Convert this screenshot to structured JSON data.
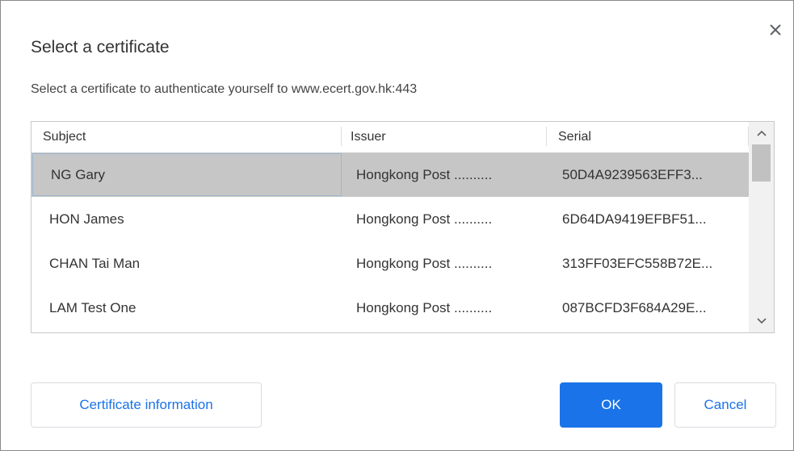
{
  "dialog": {
    "title": "Select a certificate",
    "subtitle": "Select a certificate to authenticate yourself to www.ecert.gov.hk:443",
    "close_icon": "close-icon"
  },
  "table": {
    "columns": [
      "Subject",
      "Issuer",
      "Serial"
    ],
    "rows": [
      {
        "subject": "NG Gary",
        "issuer": "Hongkong Post ..........",
        "serial": "50D4A9239563EFF3...",
        "selected": true
      },
      {
        "subject": "HON James",
        "issuer": "Hongkong Post ..........",
        "serial": "6D64DA9419EFBF51...",
        "selected": false
      },
      {
        "subject": "CHAN Tai Man",
        "issuer": "Hongkong Post ..........",
        "serial": "313FF03EFC558B72E...",
        "selected": false
      },
      {
        "subject": "LAM Test One",
        "issuer": "Hongkong Post ..........",
        "serial": "087BCFD3F684A29E...",
        "selected": false
      }
    ]
  },
  "buttons": {
    "info": "Certificate information",
    "ok": "OK",
    "cancel": "Cancel"
  },
  "colors": {
    "accent": "#1a73e8",
    "selected_row": "#c6c6c6"
  }
}
